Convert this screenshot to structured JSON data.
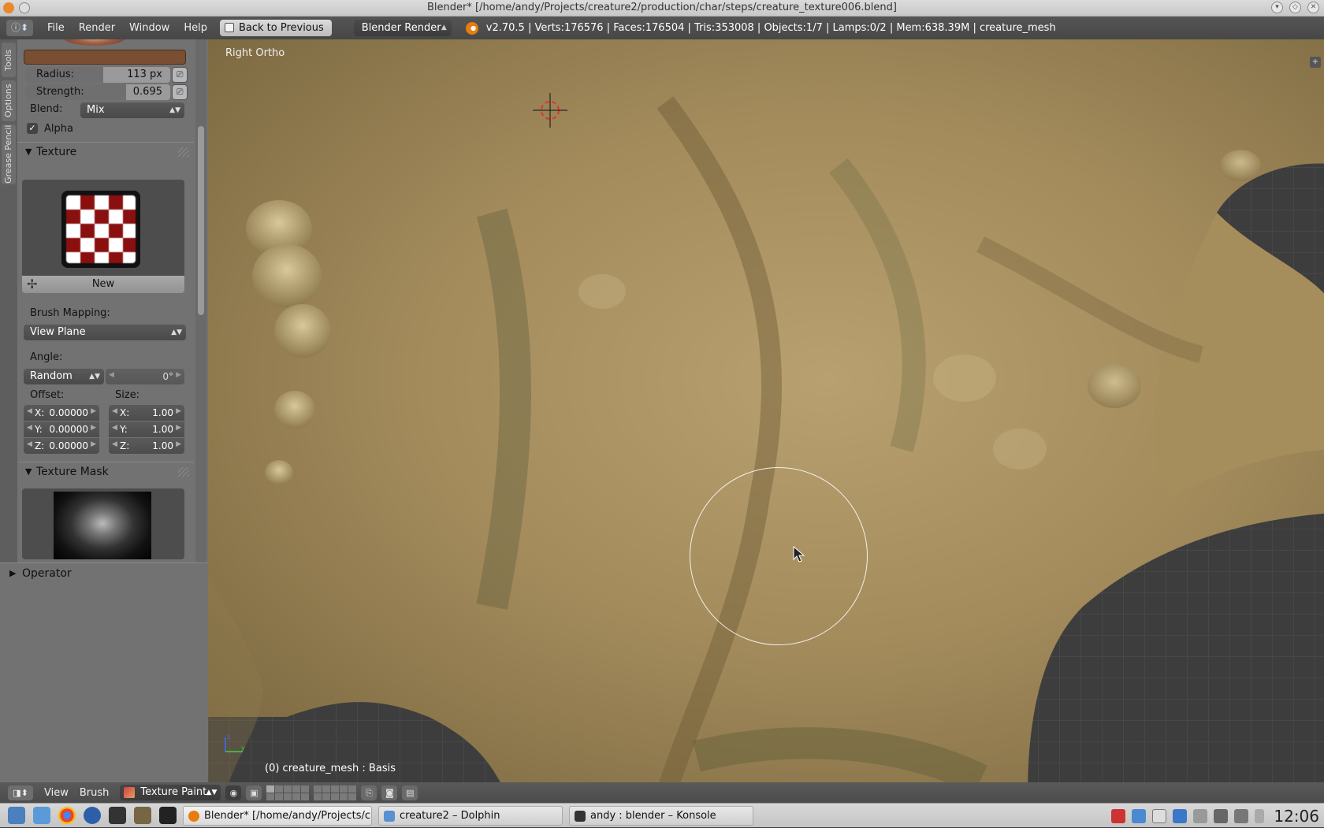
{
  "window": {
    "title": "Blender* [/home/andy/Projects/creature2/production/char/steps/creature_texture006.blend]"
  },
  "info_header": {
    "menus": [
      "File",
      "Render",
      "Window",
      "Help"
    ],
    "back_button": "Back to Previous",
    "render_engine": "Blender Render",
    "stats": "v2.70.5 | Verts:176576 | Faces:176504 | Tris:353008 | Objects:1/7 | Lamps:0/2 | Mem:638.39M | creature_mesh"
  },
  "tool_tabs": [
    "Tools",
    "Options",
    "Grease Pencil"
  ],
  "brush": {
    "radius_label": "Radius:",
    "radius_value": "113 px",
    "strength_label": "Strength:",
    "strength_value": "0.695",
    "strength_fraction": 0.695,
    "blend_label": "Blend:",
    "blend_value": "Mix",
    "alpha_label": "Alpha",
    "alpha_checked": true
  },
  "texture_panel": {
    "title": "Texture",
    "new_button": "New",
    "brush_mapping_label": "Brush Mapping:",
    "brush_mapping_value": "View Plane",
    "angle_label": "Angle:",
    "angle_mode": "Random",
    "angle_value": "0°",
    "offset_label": "Offset:",
    "size_label": "Size:",
    "offset": {
      "x": "0.00000",
      "y": "0.00000",
      "z": "0.00000"
    },
    "size": {
      "x": "1.00",
      "y": "1.00",
      "z": "1.00"
    }
  },
  "texture_mask_panel": {
    "title": "Texture Mask"
  },
  "operator_panel": {
    "title": "Operator"
  },
  "viewport": {
    "view_name": "Right Ortho",
    "object_info": "(0) creature_mesh : Basis",
    "brush_color": "#f4f0e8"
  },
  "view3d_header": {
    "menus": [
      "View",
      "Brush"
    ],
    "mode": "Texture Paint"
  },
  "taskbar": {
    "tasks": [
      "Blender* [/home/andy/Projects/cre",
      "creature2 – Dolphin",
      "andy : blender – Konsole"
    ],
    "clock": "12:06"
  },
  "colors": {
    "brush_color_swatch": "#7a4e30",
    "blender_orange": "#e87d0d"
  }
}
